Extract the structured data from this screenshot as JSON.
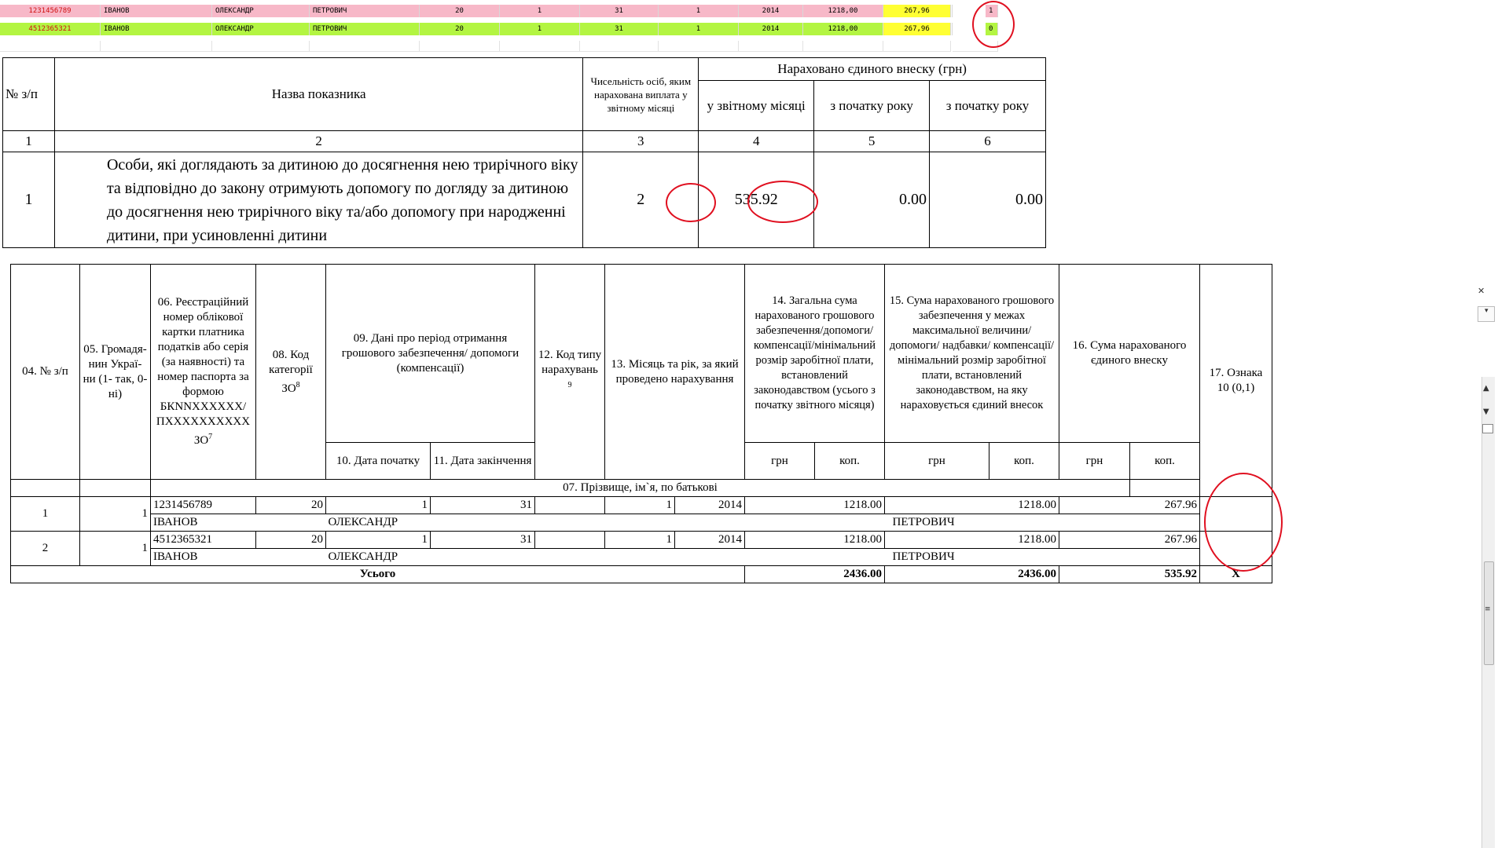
{
  "sheet_rows": [
    {
      "id": "1231456789",
      "surname": "ІВАНОВ",
      "name": "ОЛЕКСАНДР",
      "patronymic": "ПЕТРОВИЧ",
      "cat": "20",
      "d1": "1",
      "d2": "31",
      "month": "1",
      "year": "2014",
      "sum": "1218,00",
      "contrib": "267,96",
      "flag": "1"
    },
    {
      "id": "4512365321",
      "surname": "ІВАНОВ",
      "name": "ОЛЕКСАНДР",
      "patronymic": "ПЕТРОВИЧ",
      "cat": "20",
      "d1": "1",
      "d2": "31",
      "month": "1",
      "year": "2014",
      "sum": "1218,00",
      "contrib": "267,96",
      "flag": "0"
    }
  ],
  "summary_table": {
    "h_num": "№ з/п",
    "h_name": "Назва показника",
    "h_count": "Чисельність осіб, яким нарахована виплата у звітному місяці",
    "h_accrued": "Нараховано єдиного внеску (грн)",
    "h_month": "у звітному місяці",
    "h_year1": "з початку року",
    "h_year2": "з початку року",
    "n1": "1",
    "n2": "2",
    "n3": "3",
    "n4": "4",
    "n5": "5",
    "n6": "6",
    "row_num": "1",
    "row_text": "Особи, які доглядають за дитиною до досягнення нею трирічного віку та відповідно до закону отримують допомогу по догляду за дитиною до досягнення нею трирічного віку та/або допомогу при народженні дитини, при усиновленні дитини",
    "row_count": "2",
    "row_month": "535.92",
    "row_year1": "0.00",
    "row_year2": "0.00"
  },
  "detail_table": {
    "h04": "04. № з/п",
    "h05": "05. Громадя-нин Украї-ни (1- так, 0-ні)",
    "h06": "06. Реєстраційний номер облікової картки платника податків або серія (за наявності) та номер паспорта за формою БКNNXXXXXX/ ПХXXXXXXXXX ЗО",
    "h06_sup": "7",
    "h08": "08. Код категорії ЗО",
    "h08_sup": "8",
    "h09": "09. Дані про період отримання грошового забезпечення/ допомоги (компенсації)",
    "h10": "10. Дата початку",
    "h11": "11. Дата закінчення",
    "h12": "12. Код типу нарахувань",
    "h12_sup": "9",
    "h13": "13. Місяць та рік, за який проведено нарахування",
    "h14": "14. Загальна сума нарахованого грошового забезпечення/допомоги/ компенсації/мінімальний розмір заробітної плати, встановлений законодавством (усього з початку звітного місяця)",
    "h15": "15. Сума нарахованого грошового забезпечення у межах максимальної величини/ допомоги/ надбавки/ компенсації/мінімальний розмір заробітної плати, встановлений законодавством, на яку нараховується єдиний внесок",
    "h16": "16. Сума нарахованого єдиного внеску",
    "h17": "17. Ознака 10 (0,1)",
    "grn": "грн",
    "kop": "коп.",
    "h07": "07. Прізвище, ім`я, по батькові",
    "rows": [
      {
        "num": "1",
        "citizen": "1",
        "id": "1231456789",
        "cat": "20",
        "d1": "1",
        "d2": "31",
        "month": "1",
        "year": "2014",
        "sum14": "1218.00",
        "sum15": "1218.00",
        "sum16": "267.96",
        "surname": "ІВАНОВ",
        "name": "ОЛЕКСАНДР",
        "patronymic": "ПЕТРОВИЧ"
      },
      {
        "num": "2",
        "citizen": "1",
        "id": "4512365321",
        "cat": "20",
        "d1": "1",
        "d2": "31",
        "month": "1",
        "year": "2014",
        "sum14": "1218.00",
        "sum15": "1218.00",
        "sum16": "267.96",
        "surname": "ІВАНОВ",
        "name": "ОЛЕКСАНДР",
        "patronymic": "ПЕТРОВИЧ"
      }
    ],
    "total_label": "Усього",
    "total14": "2436.00",
    "total15": "2436.00",
    "total16": "535.92",
    "total17": "X"
  },
  "annotation_color": "#e01020",
  "scroll_icons": {
    "close": "close-icon",
    "dropdown": "dropdown-arrow-icon",
    "up": "scroll-up-icon",
    "down": "scroll-down-icon",
    "grip": "grip-icon"
  }
}
